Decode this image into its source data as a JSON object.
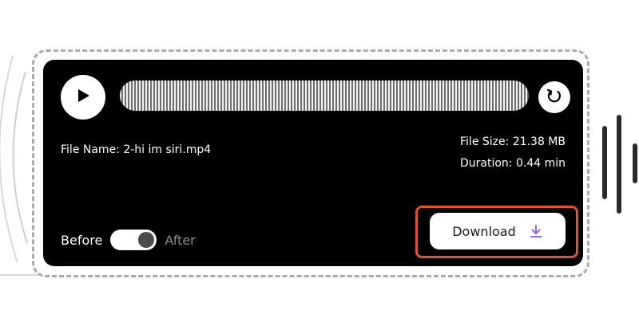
{
  "player": {
    "file_name": "File Name: 2-hi im siri.mp4",
    "file_size": "File Size: 21.38 MB",
    "duration": "Duration: 0.44 min",
    "toggle": {
      "before_label": "Before",
      "after_label": "After"
    },
    "download_label": "Download"
  },
  "colors": {
    "card_bg": "#000000",
    "highlight": "#e55233",
    "download_icon": "#8b6ad8",
    "dashed_border": "#a9a9a9"
  },
  "icons": {
    "play": "play-icon",
    "reset": "reset-icon",
    "download": "download-icon"
  }
}
